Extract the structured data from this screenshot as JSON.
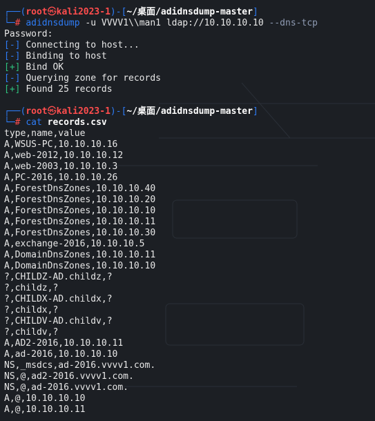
{
  "prompt": {
    "user": "root",
    "skull": "㉿",
    "host": "kali2023-1",
    "path": "~/桌面/adidnsdump-master",
    "symbol": "#"
  },
  "cmd1": {
    "program": "adidnsdump",
    "args": "-u VVVV1\\\\man1 ldap://10.10.10.10",
    "flag": "--dns-tcp"
  },
  "output1": [
    {
      "tag": "",
      "text": "Password:"
    },
    {
      "tag": "[-]",
      "text": "Connecting to host..."
    },
    {
      "tag": "[-]",
      "text": "Binding to host"
    },
    {
      "tag": "[+]",
      "text": "Bind OK"
    },
    {
      "tag": "[-]",
      "text": "Querying zone for records"
    },
    {
      "tag": "[+]",
      "text": "Found 25 records"
    }
  ],
  "cmd2": {
    "program": "cat",
    "file": "records.csv"
  },
  "csv_lines": [
    "type,name,value",
    "A,WSUS-PC,10.10.10.16",
    "A,web-2012,10.10.10.12",
    "A,web-2003,10.10.10.3",
    "A,PC-2016,10.10.10.26",
    "A,ForestDnsZones,10.10.10.40",
    "A,ForestDnsZones,10.10.10.20",
    "A,ForestDnsZones,10.10.10.10",
    "A,ForestDnsZones,10.10.10.11",
    "A,ForestDnsZones,10.10.10.30",
    "A,exchange-2016,10.10.10.5",
    "A,DomainDnsZones,10.10.10.11",
    "A,DomainDnsZones,10.10.10.10",
    "?,CHILDZ-AD.childz,?",
    "?,childz,?",
    "?,CHILDX-AD.childx,?",
    "?,childx,?",
    "?,CHILDV-AD.childv,?",
    "?,childv,?",
    "A,AD2-2016,10.10.10.11",
    "A,ad-2016,10.10.10.10",
    "NS,_msdcs,ad-2016.vvvv1.com.",
    "NS,@,ad2-2016.vvvv1.com.",
    "NS,@,ad-2016.vvvv1.com.",
    "A,@,10.10.10.10",
    "A,@,10.10.10.11"
  ],
  "colors": {
    "background": "#1c1f24",
    "frame": "#2e7cf6",
    "root": "#ff4d4d",
    "ok": "#2ec27e"
  }
}
